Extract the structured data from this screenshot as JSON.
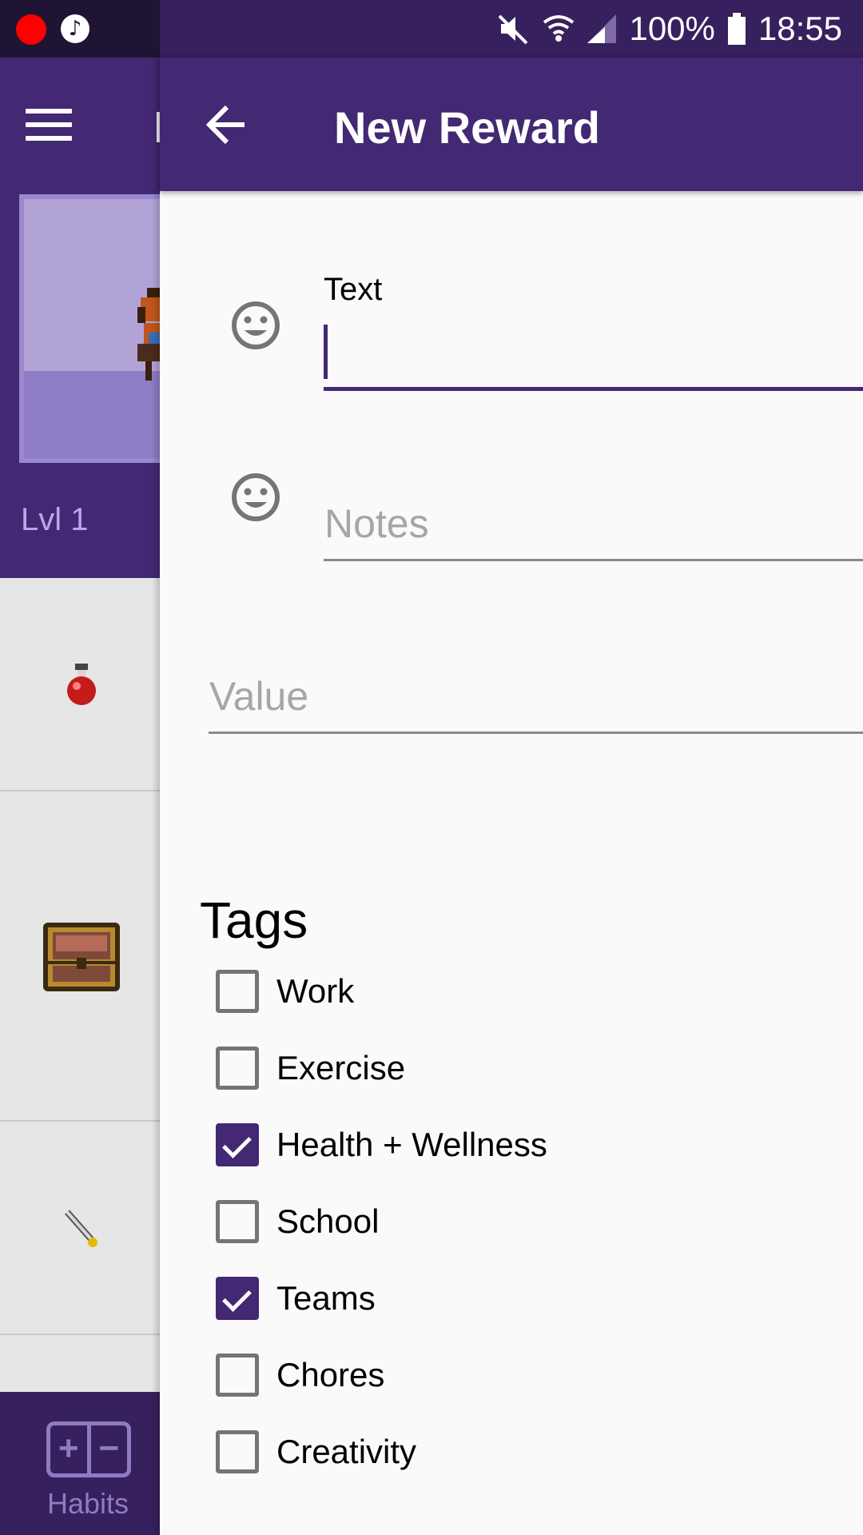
{
  "status_bar": {
    "battery": "100%",
    "time": "18:55"
  },
  "background": {
    "level": "Lvl 1",
    "bottom_nav_label": "Habits",
    "habits_icon_plus": "+",
    "habits_icon_minus": "−"
  },
  "dialog": {
    "title": "New Reward",
    "text_field": {
      "label": "Text",
      "value": ""
    },
    "notes_field": {
      "placeholder": "Notes"
    },
    "value_field": {
      "placeholder": "Value"
    },
    "tags_title": "Tags",
    "tags": [
      {
        "label": "Work",
        "checked": false
      },
      {
        "label": "Exercise",
        "checked": false
      },
      {
        "label": "Health + Wellness",
        "checked": true
      },
      {
        "label": "School",
        "checked": false
      },
      {
        "label": "Teams",
        "checked": true
      },
      {
        "label": "Chores",
        "checked": false
      },
      {
        "label": "Creativity",
        "checked": false
      }
    ]
  },
  "colors": {
    "primary": "#432874",
    "status_bar": "#36205e",
    "accent_text": "#8e7cc3"
  },
  "icons": {
    "menu": "menu-icon",
    "back": "arrow-left-icon",
    "emoji": "smiley-face-icon",
    "potion": "health-potion-icon",
    "chest": "treasure-chest-icon",
    "sword": "sword-icon"
  }
}
